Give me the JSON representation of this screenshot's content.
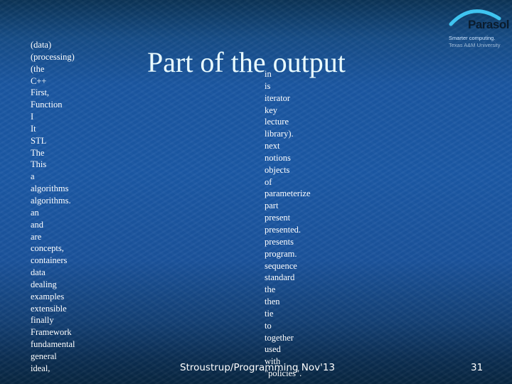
{
  "slide": {
    "title": "Part of the output",
    "left_column": [
      "(data)",
      "(processing)",
      "(the",
      "C++",
      "First,",
      "Function",
      "I",
      "It",
      "STL",
      "The",
      "This",
      "a",
      "algorithms",
      "algorithms.",
      "an",
      "and",
      "are",
      "concepts,",
      "containers",
      "data",
      "dealing",
      "examples",
      "extensible",
      "finally",
      "Framework",
      "fundamental",
      "general",
      "ideal,"
    ],
    "right_column": [
      "in",
      "is",
      "iterator",
      "key",
      "lecture",
      "library).",
      "next",
      "notions",
      "objects",
      "of",
      "parameterize",
      "part",
      "present",
      "presented.",
      "presents",
      "program.",
      "sequence",
      "standard",
      "the",
      "then",
      "tie",
      "to",
      "together",
      "used",
      "with",
      "\"policies\"."
    ],
    "footer": "Stroustrup/Programming Nov'13",
    "page_number": "31"
  },
  "logo": {
    "name": "Parasol",
    "tagline": "Smarter computing.",
    "institution": "Texas A&M University",
    "arc_color": "#3fc4f0"
  }
}
